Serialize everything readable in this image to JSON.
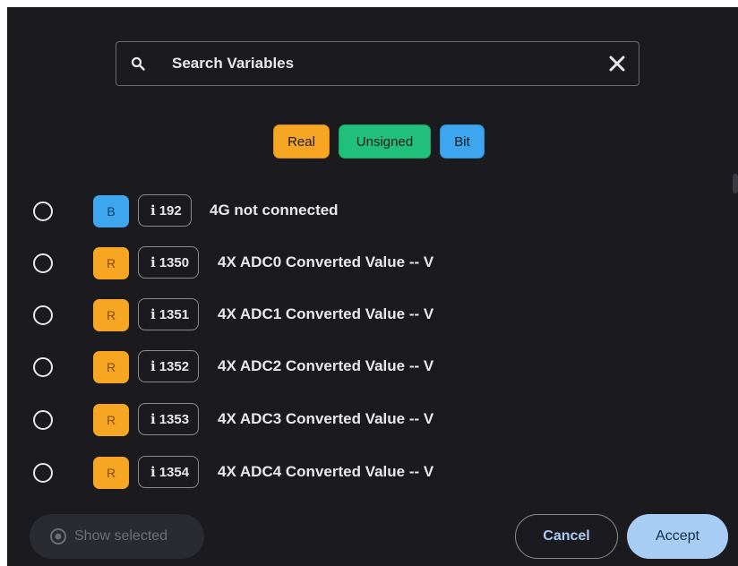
{
  "search": {
    "placeholder": "Search Variables",
    "value": ""
  },
  "filters": [
    {
      "label": "Real",
      "color": "#f6a623"
    },
    {
      "label": "Unsigned",
      "color": "#20c07a"
    },
    {
      "label": "Bit",
      "color": "#3ea6ee"
    }
  ],
  "variables": [
    {
      "type": "B",
      "id": "192",
      "label": "4G not connected",
      "selected": false
    },
    {
      "type": "R",
      "id": "1350",
      "label": "4X ADC0 Converted Value -- V",
      "selected": false
    },
    {
      "type": "R",
      "id": "1351",
      "label": "4X ADC1 Converted Value -- V",
      "selected": false
    },
    {
      "type": "R",
      "id": "1352",
      "label": "4X ADC2 Converted Value -- V",
      "selected": false
    },
    {
      "type": "R",
      "id": "1353",
      "label": "4X ADC3 Converted Value -- V",
      "selected": false
    },
    {
      "type": "R",
      "id": "1354",
      "label": "4X ADC4 Converted Value -- V",
      "selected": false
    }
  ],
  "footer": {
    "show_selected_label": "Show selected",
    "cancel_label": "Cancel",
    "accept_label": "Accept"
  },
  "icons": {
    "search": "search-icon",
    "clear": "close-icon",
    "show_selected": "eye-icon",
    "info": "info-icon"
  },
  "colors": {
    "background": "#1b1b1f",
    "text": "#e8e8ec",
    "accent": "#a8cdf5"
  }
}
